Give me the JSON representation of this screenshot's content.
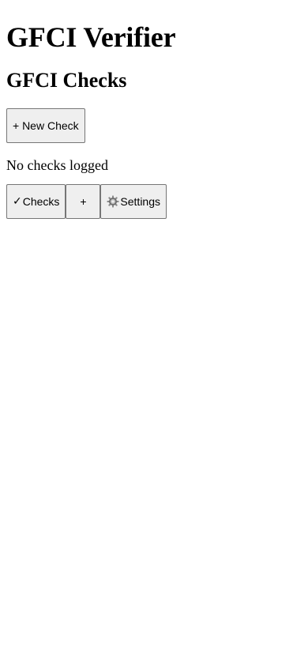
{
  "app": {
    "title": "GFCI Verifier"
  },
  "checks_view": {
    "heading": "GFCI Checks",
    "new_check_label": "+ New Check",
    "empty_message": "No checks logged"
  },
  "bottom_nav": {
    "checks": {
      "icon": "checkmark-icon",
      "glyph": "✓",
      "label": "Checks"
    },
    "add": {
      "icon": "plus-icon",
      "label": "+"
    },
    "settings": {
      "icon": "gear-icon",
      "label": "Settings"
    }
  }
}
